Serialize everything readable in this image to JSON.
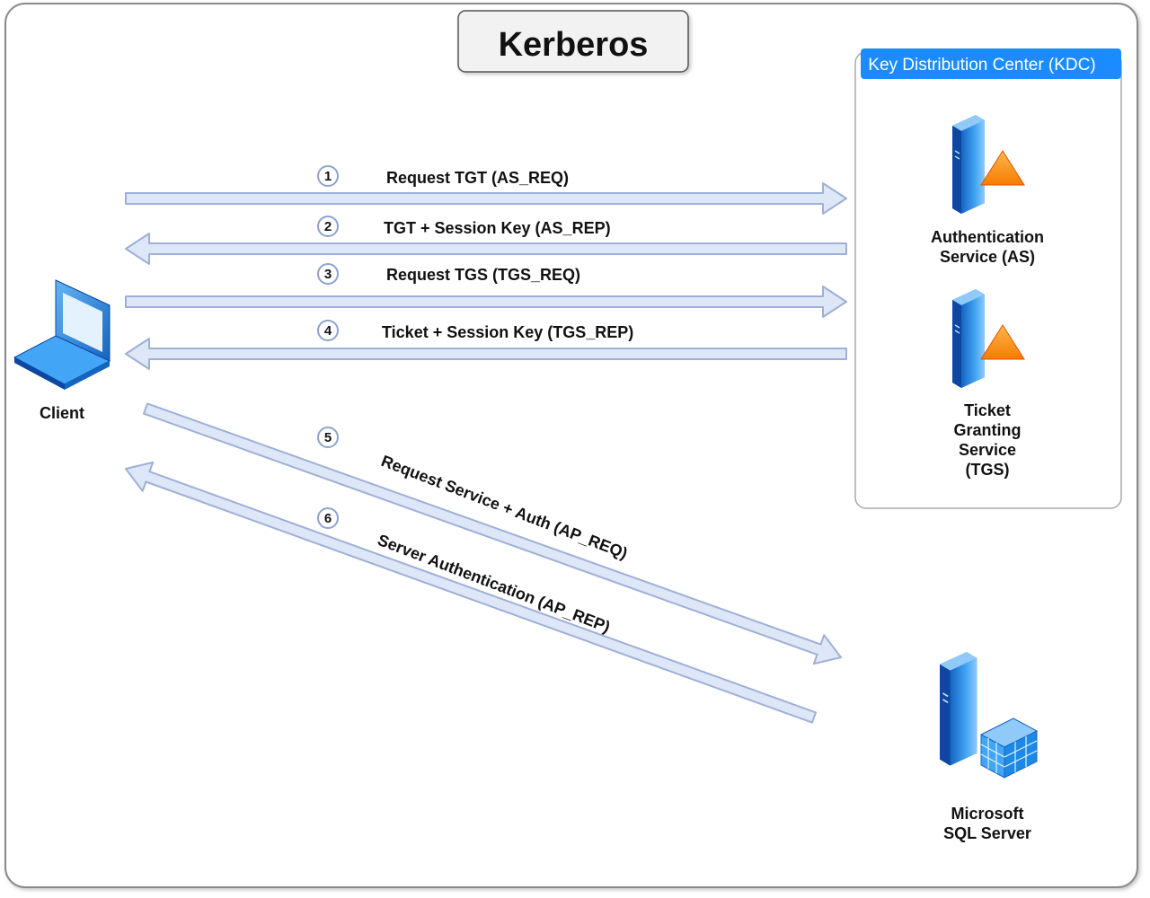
{
  "title": "Kerberos",
  "kdc": {
    "header": "Key Distribution Center (KDC)"
  },
  "nodes": {
    "client": "Client",
    "as": [
      "Authentication",
      "Service (AS)"
    ],
    "tgs": [
      "Ticket",
      "Granting",
      "Service",
      "(TGS)"
    ],
    "sql": [
      "Microsoft",
      "SQL Server"
    ]
  },
  "steps": [
    {
      "num": "1",
      "label": "Request TGT (AS_REQ)"
    },
    {
      "num": "2",
      "label": "TGT + Session Key (AS_REP)"
    },
    {
      "num": "3",
      "label": "Request TGS (TGS_REQ)"
    },
    {
      "num": "4",
      "label": "Ticket + Session Key (TGS_REP)"
    },
    {
      "num": "5",
      "label": "Request Service + Auth (AP_REQ)"
    },
    {
      "num": "6",
      "label": "Server Authentication (AP_REP)"
    }
  ],
  "colors": {
    "arrow_fill": "#dde7f7",
    "arrow_stroke": "#9fb0d6",
    "kdc_header": "#1a8cff",
    "server_blue": "#1565c0",
    "triangle_orange": "#f7931e"
  }
}
